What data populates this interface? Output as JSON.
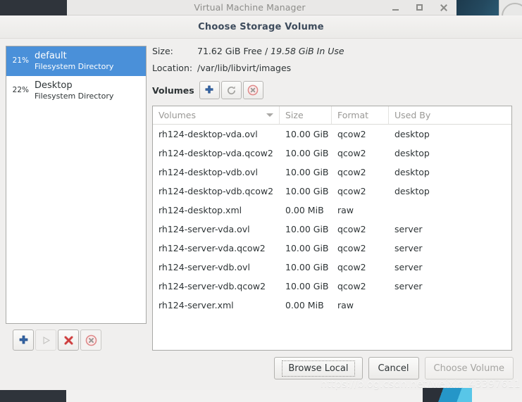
{
  "window": {
    "title": "Virtual Machine Manager",
    "controls": [
      {
        "name": "minimize-button",
        "icon": "minimize-icon",
        "label": "_"
      },
      {
        "name": "maximize-button",
        "icon": "maximize-icon",
        "label": "□"
      },
      {
        "name": "close-button",
        "icon": "close-icon",
        "label": "✕"
      }
    ]
  },
  "dialog": {
    "title": "Choose Storage Volume"
  },
  "pools": {
    "items": [
      {
        "percent": "21%",
        "name": "default",
        "type": "Filesystem Directory",
        "selected": true
      },
      {
        "percent": "22%",
        "name": "Desktop",
        "type": "Filesystem Directory",
        "selected": false
      }
    ],
    "toolbar": [
      {
        "name": "add-pool-button",
        "icon": "plus-icon",
        "state": "enabled"
      },
      {
        "name": "start-pool-button",
        "icon": "play-icon",
        "state": "disabled"
      },
      {
        "name": "stop-pool-button",
        "icon": "stop-x-icon",
        "state": "enabled"
      },
      {
        "name": "delete-pool-button",
        "icon": "delete-circle-icon",
        "state": "enabled"
      }
    ]
  },
  "info": {
    "size_label": "Size:",
    "size_free": "71.62 GiB Free",
    "size_separator": " / ",
    "size_inuse": "19.58 GiB In Use",
    "location_label": "Location:",
    "location_value": "/var/lib/libvirt/images"
  },
  "volumes_section": {
    "label": "Volumes",
    "toolbar": [
      {
        "name": "new-volume-button",
        "icon": "plus-icon"
      },
      {
        "name": "refresh-volumes-button",
        "icon": "refresh-icon"
      },
      {
        "name": "delete-volume-button",
        "icon": "delete-circle-icon"
      }
    ]
  },
  "table": {
    "columns": [
      {
        "key": "volumes",
        "label": "Volumes",
        "sort": "descending"
      },
      {
        "key": "size",
        "label": "Size"
      },
      {
        "key": "format",
        "label": "Format"
      },
      {
        "key": "used_by",
        "label": "Used By"
      }
    ],
    "rows": [
      {
        "volumes": "rh124-desktop-vda.ovl",
        "size": "10.00 GiB",
        "format": "qcow2",
        "used_by": "desktop"
      },
      {
        "volumes": "rh124-desktop-vda.qcow2",
        "size": "10.00 GiB",
        "format": "qcow2",
        "used_by": "desktop"
      },
      {
        "volumes": "rh124-desktop-vdb.ovl",
        "size": "10.00 GiB",
        "format": "qcow2",
        "used_by": "desktop"
      },
      {
        "volumes": "rh124-desktop-vdb.qcow2",
        "size": "10.00 GiB",
        "format": "qcow2",
        "used_by": "desktop"
      },
      {
        "volumes": "rh124-desktop.xml",
        "size": "0.00 MiB",
        "format": "raw",
        "used_by": ""
      },
      {
        "volumes": "rh124-server-vda.ovl",
        "size": "10.00 GiB",
        "format": "qcow2",
        "used_by": "server"
      },
      {
        "volumes": "rh124-server-vda.qcow2",
        "size": "10.00 GiB",
        "format": "qcow2",
        "used_by": "server"
      },
      {
        "volumes": "rh124-server-vdb.ovl",
        "size": "10.00 GiB",
        "format": "qcow2",
        "used_by": "server"
      },
      {
        "volumes": "rh124-server-vdb.qcow2",
        "size": "10.00 GiB",
        "format": "qcow2",
        "used_by": "server"
      },
      {
        "volumes": "rh124-server.xml",
        "size": "0.00 MiB",
        "format": "raw",
        "used_by": ""
      }
    ]
  },
  "footer": {
    "browse_local": "Browse Local",
    "cancel": "Cancel",
    "choose_volume": "Choose Volume"
  },
  "watermark": "https://blog.csdn.net/weixin_43397611",
  "colors": {
    "selection_blue": "#4a90d9",
    "dialog_bg": "#f0efee",
    "title_text": "#3d4b5c",
    "header_text": "#9a9996",
    "accent_plus": "#3465a4",
    "accent_red": "#cc4b4b"
  }
}
